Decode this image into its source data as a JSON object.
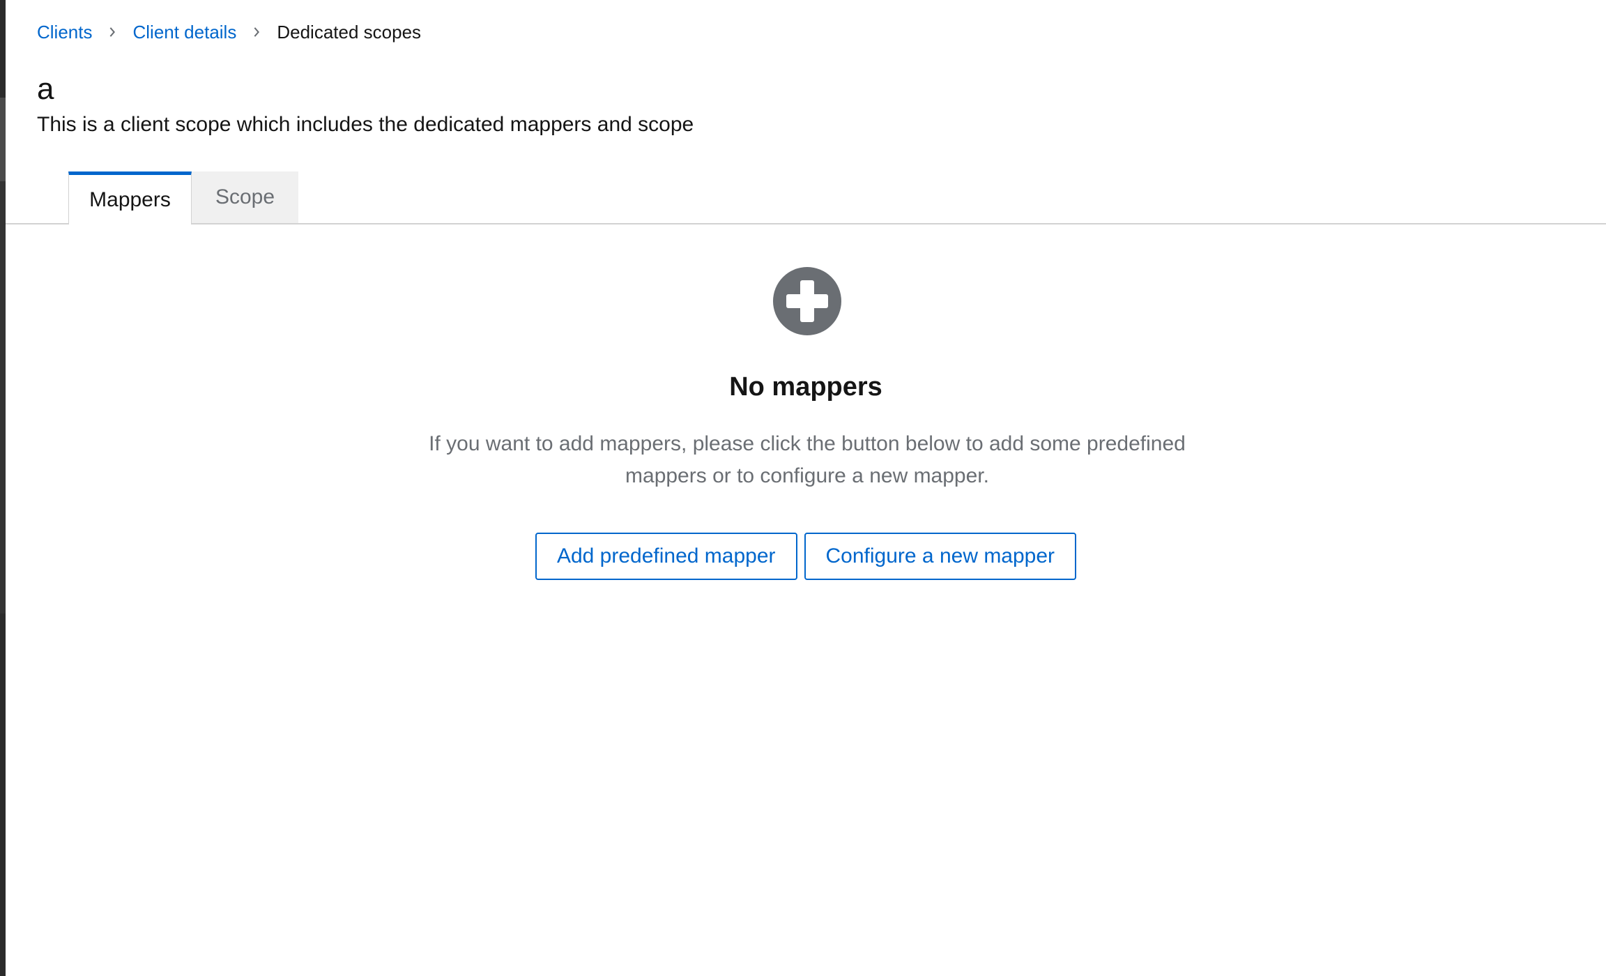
{
  "breadcrumb": {
    "items": [
      {
        "label": "Clients"
      },
      {
        "label": "Client details"
      },
      {
        "label": "Dedicated scopes"
      }
    ]
  },
  "header": {
    "title": "a",
    "description": "This is a client scope which includes the dedicated mappers and scope"
  },
  "tabs": [
    {
      "label": "Mappers",
      "active": true
    },
    {
      "label": "Scope",
      "active": false
    }
  ],
  "empty_state": {
    "icon": "plus-circle-icon",
    "title": "No mappers",
    "body": "If you want to add mappers, please click the button below to add some predefined mappers or to configure a new mapper.",
    "actions": {
      "add_predefined": "Add predefined mapper",
      "configure_new": "Configure a new mapper"
    }
  },
  "colors": {
    "link": "#0066cc",
    "icon": "#6a6e73",
    "tab_active_border": "#0066cc"
  }
}
